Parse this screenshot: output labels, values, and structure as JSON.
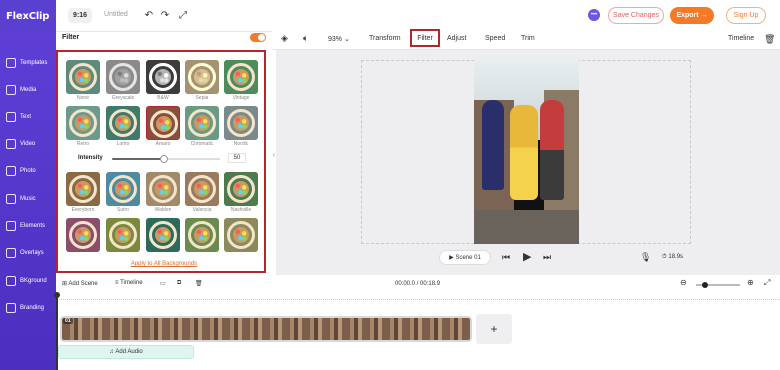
{
  "app": {
    "logo": "FlexClip",
    "ratio": "9:16",
    "project_title": "Untitled"
  },
  "header": {
    "save_changes": "Save Changes",
    "export": "Export",
    "signup": "Sign Up"
  },
  "sidebar": {
    "items": [
      {
        "label": "Templates",
        "icon": "templates-icon"
      },
      {
        "label": "Media",
        "icon": "media-icon"
      },
      {
        "label": "Text",
        "icon": "text-icon"
      },
      {
        "label": "Video",
        "icon": "video-icon"
      },
      {
        "label": "Photo",
        "icon": "photo-icon"
      },
      {
        "label": "Music",
        "icon": "music-icon"
      },
      {
        "label": "Elements",
        "icon": "elements-icon"
      },
      {
        "label": "Overlays",
        "icon": "overlays-icon"
      },
      {
        "label": "BKground",
        "icon": "background-icon"
      },
      {
        "label": "Branding",
        "icon": "branding-icon"
      }
    ]
  },
  "filter": {
    "title": "Filter",
    "enabled": true,
    "row1": [
      "None",
      "Greyscale",
      "B&W",
      "Sepia",
      "Vintage"
    ],
    "row2": [
      "Retro",
      "Lomo",
      "Amaro",
      "Chromatic",
      "Nordic"
    ],
    "intensity_label": "Intensity",
    "intensity_value": "50",
    "row3": [
      "Everyborn",
      "Sutro",
      "Walden",
      "Valencia",
      "Nashville"
    ],
    "row4": [
      "",
      "",
      "",
      "",
      ""
    ],
    "apply_all": "Apply to All Backgrounds",
    "selected": "Amaro"
  },
  "toolbar": {
    "zoom": "93%",
    "transform": "Transform",
    "filter": "Filter",
    "adjust": "Adjust",
    "speed": "Speed",
    "trim": "Trim",
    "timeline": "Timeline"
  },
  "player": {
    "scene": "Scene 01",
    "duration": "18.9s"
  },
  "timeline": {
    "add_scene": "Add Scene",
    "timeline_label": "Timeline",
    "time_readout": "00:00.0 / 00:18.9",
    "clip_index": "01",
    "add_audio": "Add Audio"
  },
  "colors": {
    "brand_purple": "#5b3fd0",
    "accent_orange": "#f47a28",
    "highlight_red": "#b3262b"
  }
}
